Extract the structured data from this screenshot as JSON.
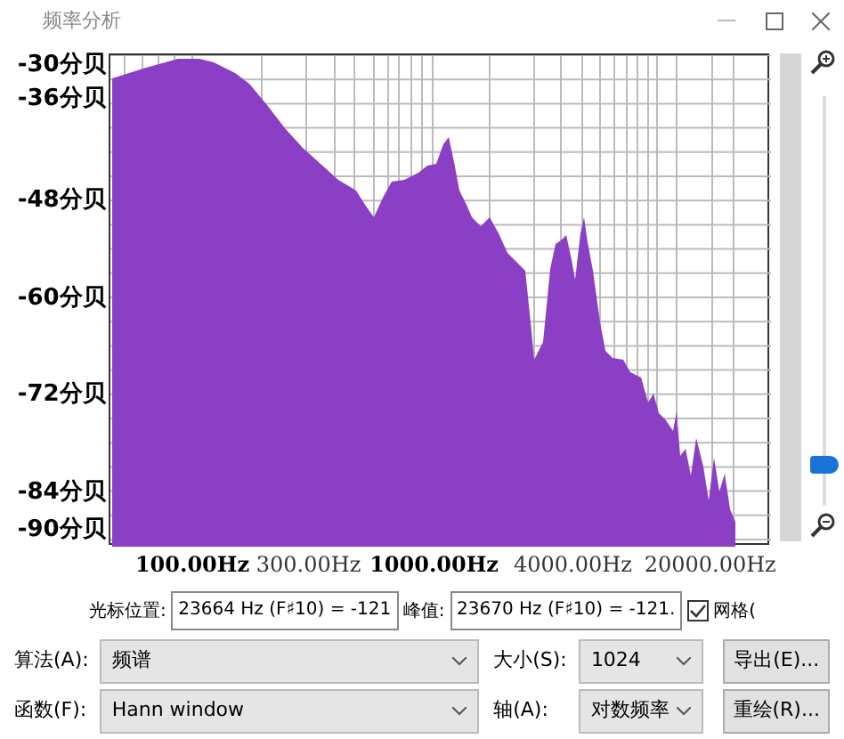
{
  "window": {
    "title": "频率分析"
  },
  "plot": {
    "y_labels": [
      "-30分贝",
      "-36分贝",
      "-48分贝",
      "-60分贝",
      "-72分贝",
      "-84分贝",
      "-90分贝"
    ],
    "x_labels": [
      {
        "text": "100.00Hz",
        "major": true
      },
      {
        "text": "300.00Hz",
        "major": false
      },
      {
        "text": "1000.00Hz",
        "major": true
      },
      {
        "text": "4000.00Hz",
        "major": false
      },
      {
        "text": "20000.00Hz",
        "major": false
      }
    ]
  },
  "zoom": {
    "level": 0.1
  },
  "cursor": {
    "label": "光标位置:",
    "value": "23664 Hz (F♯10) = -121"
  },
  "peak": {
    "label": "峰值:",
    "value": "23670 Hz (F♯10) = -121."
  },
  "grid": {
    "label": "网格(",
    "checked": true
  },
  "rows": [
    [
      {
        "kind": "select",
        "label": "算法(A):",
        "value": "频谱"
      },
      {
        "kind": "select",
        "label": "大小(S):",
        "value": "1024"
      },
      {
        "kind": "button",
        "label": "导出(E)..."
      }
    ],
    [
      {
        "kind": "select",
        "label": "函数(F):",
        "value": "Hann window"
      },
      {
        "kind": "select",
        "label": "轴(A):",
        "value": "对数频率"
      },
      {
        "kind": "button",
        "label": "重绘(R)..."
      }
    ]
  ]
}
